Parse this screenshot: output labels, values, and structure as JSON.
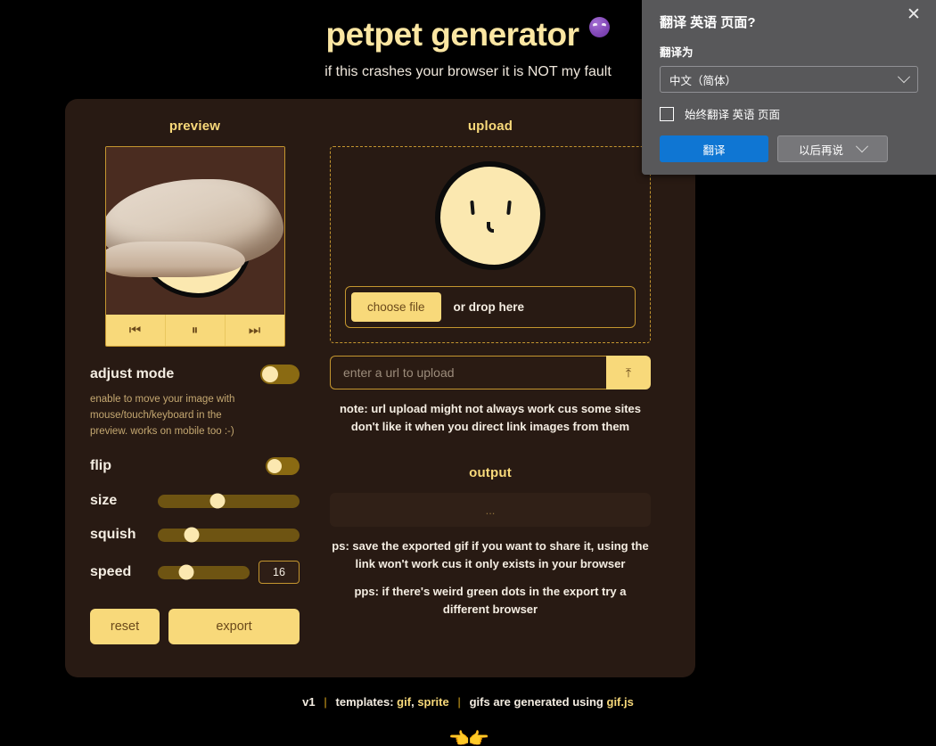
{
  "header": {
    "title": "petpet generator",
    "title_emoji": "purple-imp-emoji",
    "subtitle": "if this crashes your browser it is NOT my fault"
  },
  "preview": {
    "section_title": "preview",
    "controls": [
      {
        "name": "prev-frame",
        "glyph": "⏮"
      },
      {
        "name": "pause",
        "glyph": "⏸"
      },
      {
        "name": "next-frame",
        "glyph": "⏭"
      }
    ]
  },
  "settings": {
    "adjust_mode": {
      "label": "adjust mode",
      "value": "off"
    },
    "adjust_hint": "enable to move your image with mouse/touch/keyboard in the preview. works on mobile too :-)",
    "flip": {
      "label": "flip",
      "value": "off"
    },
    "size": {
      "label": "size",
      "percent": 42
    },
    "squish": {
      "label": "squish",
      "percent": 24
    },
    "speed": {
      "label": "speed",
      "percent": 31,
      "value": "16"
    },
    "reset_label": "reset",
    "export_label": "export"
  },
  "upload": {
    "section_title": "upload",
    "choose_file_label": "choose file",
    "drop_text": "or drop here",
    "url_placeholder": "enter a url to upload",
    "url_value": "",
    "url_submit_glyph": "⤒",
    "note": "note: url upload might not always work cus some sites don't like it when you direct link images from them"
  },
  "output": {
    "section_title": "output",
    "placeholder": "...",
    "ps": "ps: save the exported gif if you want to share it, using the link won't work cus it only exists in your browser",
    "pps": "pps: if there's weird green dots in the export try a different browser"
  },
  "footer": {
    "version": "v1",
    "templates_label": "templates:",
    "template_links": [
      "gif",
      "sprite"
    ],
    "credit_prefix": "gifs are generated using",
    "credit_link": "gif.js",
    "emoji": "👈👉"
  },
  "translate_popup": {
    "title": "翻译 英语 页面?",
    "close_glyph": "✕",
    "target_label": "翻译为",
    "selected_language": "中文（简体）",
    "always_translate_label": "始终翻译 英语 页面",
    "always_translate_checked": false,
    "primary_button": "翻译",
    "secondary_button": "以后再说"
  },
  "colors": {
    "page_bg": "#000000",
    "card_bg": "#281A13",
    "accent_yellow": "#F8D97A",
    "text_cream": "#F4EDE2",
    "gold_border": "#C4962F",
    "popup_bg": "#58585A",
    "popup_primary": "#0F76D3"
  }
}
